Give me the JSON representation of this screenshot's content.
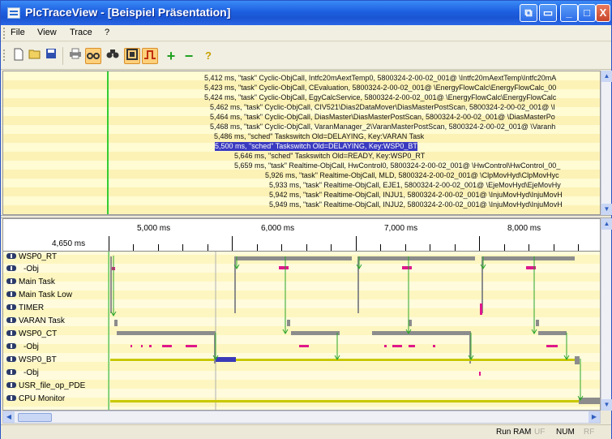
{
  "window": {
    "title": "PlcTraceView - [Beispiel Präsentation]",
    "min_label": "_",
    "max_label": "□",
    "close_label": "X"
  },
  "menu": {
    "items": [
      "File",
      "View",
      "Trace",
      "?"
    ]
  },
  "toolbar": {
    "tools": [
      "new-icon",
      "open-icon",
      "save-icon",
      "print-icon",
      "link-icon",
      "binoculars-icon",
      "frame-icon",
      "signal-icon",
      "plus-icon",
      "minus-icon",
      "help-icon"
    ]
  },
  "log": {
    "lines": [
      "5,412 ms, \"task\" Cyclic-ObjCall, Intfc20mAextTemp0, 5800324-2-00-02_001@ \\Intfc20mAextTemp\\Intfc20mA",
      "5,423 ms, \"task\" Cyclic-ObjCall, CEvaluation, 5800324-2-00-02_001@ \\EnergyFlowCalc\\EnergyFlowCalc_00",
      "5,424 ms, \"task\" Cyclic-ObjCall, EgyCalcService, 5800324-2-00-02_001@ \\EnergyFlowCalc\\EnergyFlowCalc",
      "5,462 ms, \"task\" Cyclic-ObjCall, CIV521\\Dias2DataMover\\DiasMasterPostScan, 5800324-2-00-02_001@ \\I",
      "5,464 ms, \"task\" Cyclic-ObjCall, DiasMaster\\DiasMasterPostScan, 5800324-2-00-02_001@ \\DiasMasterPo",
      "5,468 ms, \"task\" Cyclic-ObjCall, VaranManager_2\\VaranMasterPostScan, 5800324-2-00-02_001@ \\Varanh",
      "5,486 ms, \"sched\" Taskswitch Old=DELAYING, Key:VARAN Task",
      "5,500 ms, \"sched\" Taskswitch Old=DELAYING, Key:WSP0_BT",
      "5,646 ms, \"sched\" Taskswitch Old=READY, Key:WSP0_RT",
      "5,659 ms, \"task\" Realtime-ObjCall, HwControl0, 5800324-2-00-02_001@ \\HwControl\\HwControl_00_",
      "5,926 ms, \"task\" Realtime-ObjCall, MLD, 5800324-2-00-02_001@ \\ClpMovHyd\\ClpMovHyc",
      "5,933 ms, \"task\" Realtime-ObjCall, EJE1, 5800324-2-00-02_001@ \\EjeMovHyd\\EjeMovHy",
      "5,942 ms, \"task\" Realtime-ObjCall, INJU1, 5800324-2-00-02_001@ \\InjuMovHyd\\InjuMovH",
      "5,949 ms, \"task\" Realtime-ObjCall, INJU2, 5800324-2-00-02_001@ \\InjuMovHyd\\InjuMovH"
    ]
  },
  "timeline": {
    "start_label": "4,650 ms",
    "ticks": [
      "5,000 ms",
      "6,000 ms",
      "7,000 ms",
      "8,000 ms"
    ],
    "tracks": [
      "WSP0_RT",
      "-Obj",
      "Main Task",
      "Main Task Low",
      "TIMER",
      "VARAN Task",
      "WSP0_CT",
      "-Obj",
      "WSP0_BT",
      "-Obj",
      "USR_file_op_PDE",
      "CPU Monitor"
    ],
    "colors": {
      "running": "#8c8c8c",
      "obj": "#e0178c",
      "arrow": "#2aa62a",
      "bt": "#3a3ab8",
      "cpu": "#c8c800"
    }
  },
  "status": {
    "cells": [
      "Run RAM",
      "UF",
      "NUM",
      "RF"
    ]
  }
}
